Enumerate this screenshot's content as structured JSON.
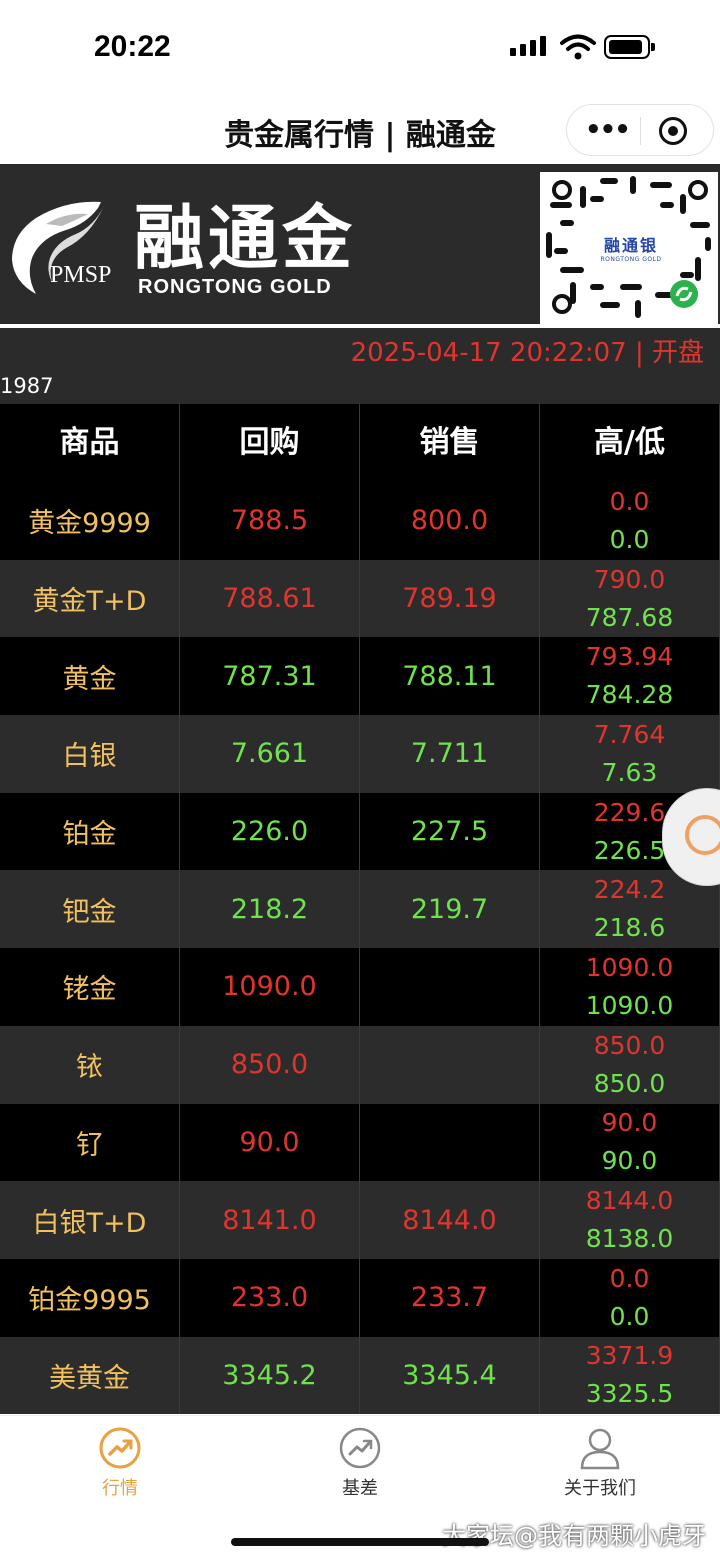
{
  "status_bar": {
    "time": "20:22"
  },
  "nav": {
    "title": "贵金属行情 | 融通金"
  },
  "banner": {
    "brand_cn": "融通金",
    "brand_en": "RONGTONG GOLD",
    "brand_abbr": "PMSP",
    "qr_label_cn": "融通银",
    "qr_label_en": "RONGTONG GOLD"
  },
  "info": {
    "datetime": "2025-04-17 20:22:07 | 开盘",
    "scroll_text": "1987"
  },
  "table": {
    "headers": [
      "商品",
      "回购",
      "销售",
      "高/低"
    ],
    "rows": [
      {
        "name": "黄金9999",
        "buy": "788.5",
        "sell": "800.0",
        "high": "0.0",
        "low": "0.0",
        "buy_color": "red",
        "sell_color": "red"
      },
      {
        "name": "黄金T+D",
        "buy": "788.61",
        "sell": "789.19",
        "high": "790.0",
        "low": "787.68",
        "buy_color": "red",
        "sell_color": "red"
      },
      {
        "name": "黄金",
        "buy": "787.31",
        "sell": "788.11",
        "high": "793.94",
        "low": "784.28",
        "buy_color": "green",
        "sell_color": "green"
      },
      {
        "name": "白银",
        "buy": "7.661",
        "sell": "7.711",
        "high": "7.764",
        "low": "7.63",
        "buy_color": "green",
        "sell_color": "green"
      },
      {
        "name": "铂金",
        "buy": "226.0",
        "sell": "227.5",
        "high": "229.6",
        "low": "226.5",
        "buy_color": "green",
        "sell_color": "green"
      },
      {
        "name": "钯金",
        "buy": "218.2",
        "sell": "219.7",
        "high": "224.2",
        "low": "218.6",
        "buy_color": "green",
        "sell_color": "green"
      },
      {
        "name": "铑金",
        "buy": "1090.0",
        "sell": "",
        "high": "1090.0",
        "low": "1090.0",
        "buy_color": "red",
        "sell_color": "red"
      },
      {
        "name": "铱",
        "buy": "850.0",
        "sell": "",
        "high": "850.0",
        "low": "850.0",
        "buy_color": "red",
        "sell_color": "red"
      },
      {
        "name": "钌",
        "buy": "90.0",
        "sell": "",
        "high": "90.0",
        "low": "90.0",
        "buy_color": "red",
        "sell_color": "red"
      },
      {
        "name": "白银T+D",
        "buy": "8141.0",
        "sell": "8144.0",
        "high": "8144.0",
        "low": "8138.0",
        "buy_color": "red",
        "sell_color": "red"
      },
      {
        "name": "铂金9995",
        "buy": "233.0",
        "sell": "233.7",
        "high": "0.0",
        "low": "0.0",
        "buy_color": "red",
        "sell_color": "red"
      },
      {
        "name": "美黄金",
        "buy": "3345.2",
        "sell": "3345.4",
        "high": "3371.9",
        "low": "3325.5",
        "buy_color": "green",
        "sell_color": "green"
      }
    ]
  },
  "tabs": [
    {
      "label": "行情",
      "icon": "trend-icon",
      "active": true
    },
    {
      "label": "基差",
      "icon": "trend-icon",
      "active": false
    },
    {
      "label": "关于我们",
      "icon": "person-icon",
      "active": false
    }
  ],
  "watermark": "大家坛@我有两颗小虎牙",
  "colors": {
    "red": "#e0352e",
    "green": "#6fe24d",
    "gold": "#f0c15e",
    "tab_active": "#e8a040",
    "tab_inactive": "#666666"
  }
}
